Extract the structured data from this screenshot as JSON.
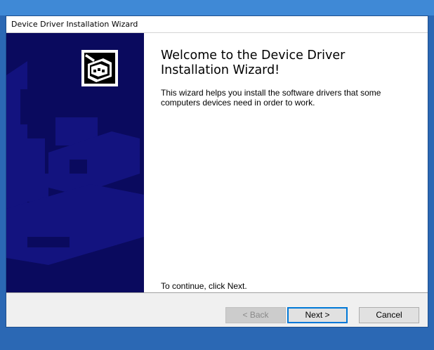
{
  "window": {
    "title": "Device Driver Installation Wizard"
  },
  "banner": {
    "icon": "driver-box-icon",
    "background_color": "#0a0a5e"
  },
  "content": {
    "heading": "Welcome to the Device Driver Installation Wizard!",
    "intro": "This wizard helps you install the software drivers that some computers devices need in order to work.",
    "continue_hint": "To continue, click Next."
  },
  "footer": {
    "back_label": "< Back",
    "next_label": "Next >",
    "cancel_label": "Cancel"
  }
}
